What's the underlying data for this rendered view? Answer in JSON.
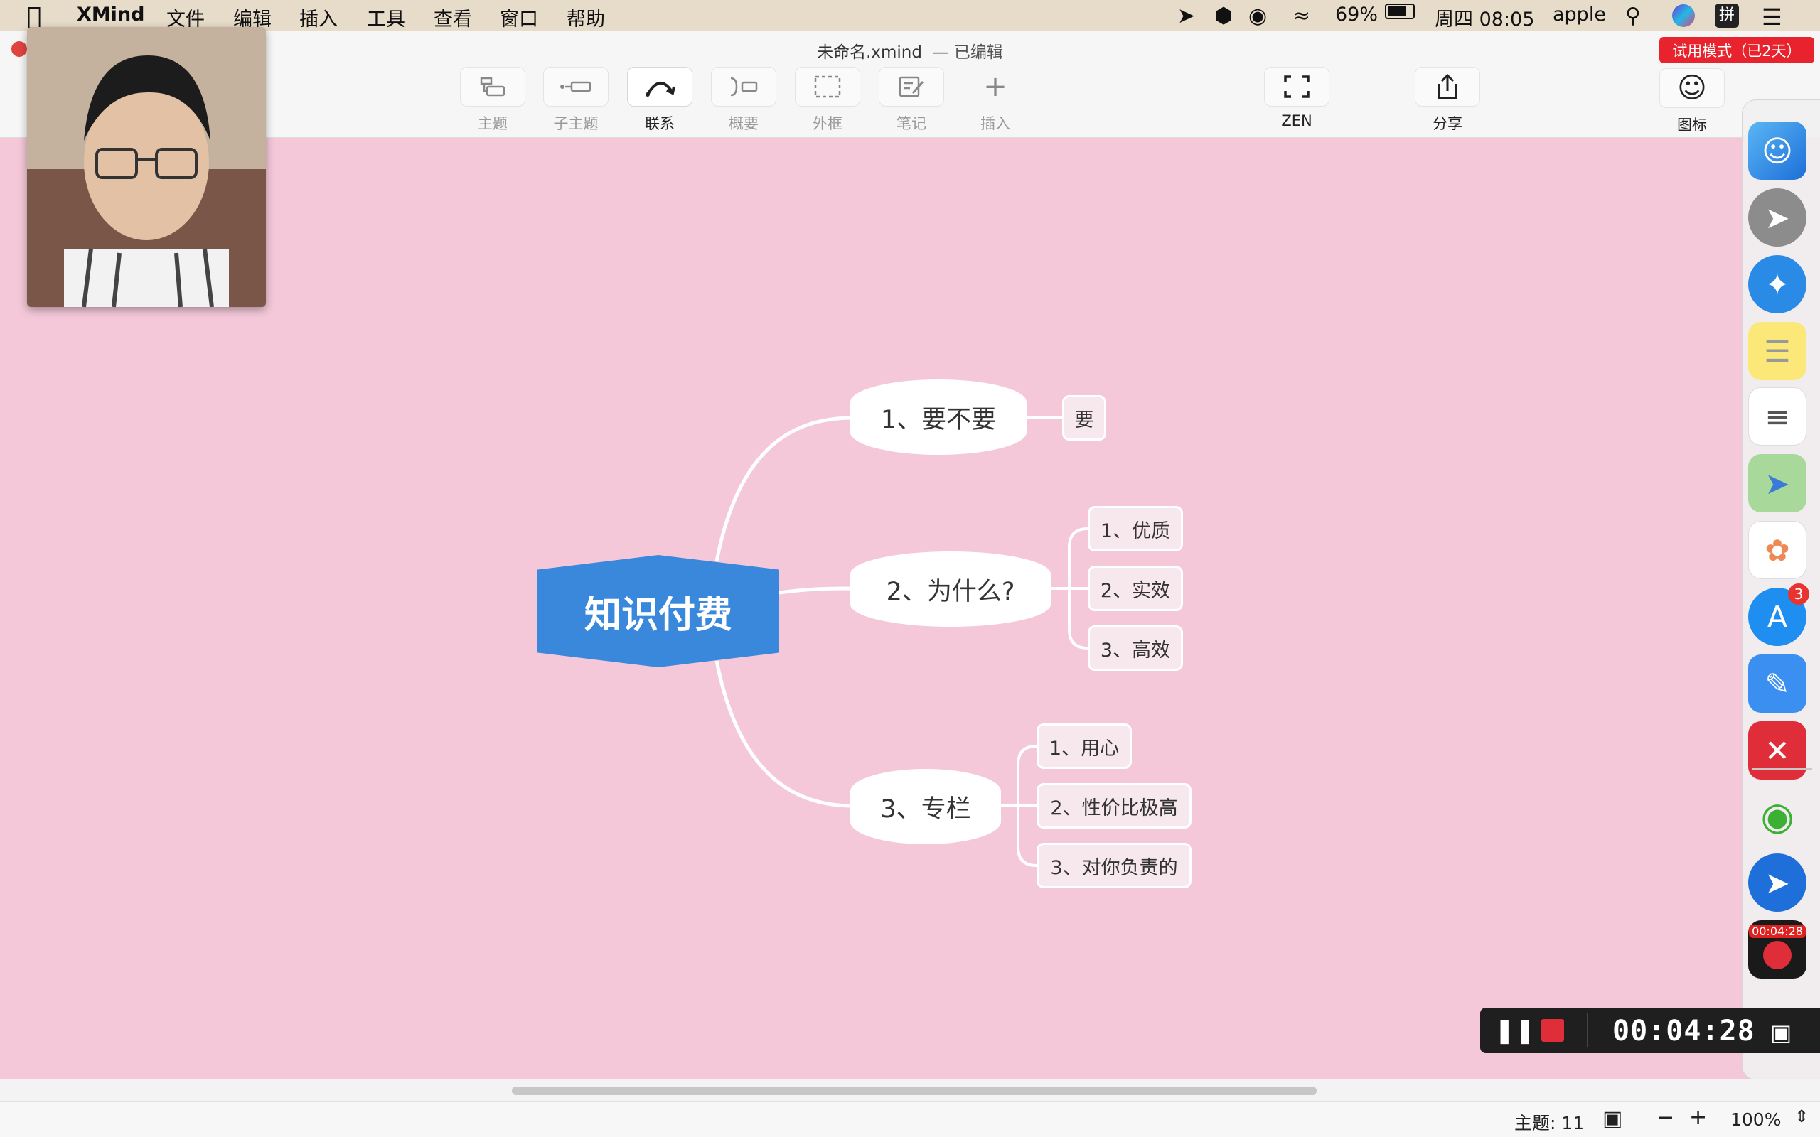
{
  "menubar": {
    "app_name": "XMind",
    "menus": [
      "文件",
      "编辑",
      "插入",
      "工具",
      "查看",
      "窗口",
      "帮助"
    ],
    "battery": "69%",
    "clock": "周四 08:05",
    "user": "apple",
    "input_method": "拼"
  },
  "window": {
    "title": "未命名.xmind",
    "edited": "— 已编辑",
    "trial_badge": "试用模式（已2天）"
  },
  "toolbar": {
    "topic": "主题",
    "subtopic": "子主题",
    "relationship": "联系",
    "summary": "概要",
    "boundary": "外框",
    "note": "笔记",
    "insert": "插入",
    "zen": "ZEN",
    "share": "分享",
    "icon": "图标"
  },
  "mindmap": {
    "central": "知识付费",
    "branches": [
      {
        "label": "1、要不要",
        "children": [
          "要"
        ]
      },
      {
        "label": "2、为什么?",
        "children": [
          "1、优质",
          "2、实效",
          "3、高效"
        ]
      },
      {
        "label": "3、专栏",
        "children": [
          "1、用心",
          "2、性价比极高",
          "3、对你负责的"
        ]
      }
    ],
    "line_color": "#ffffff",
    "central_color": "#3a88dc",
    "canvas_color": "#f4c8d8"
  },
  "dock": {
    "appstore_badge": "3",
    "recorder_time": "00:04:28"
  },
  "recording": {
    "timer": "00:04:28"
  },
  "statusbar": {
    "topic_count": "主题: 11",
    "zoom": "100%"
  }
}
